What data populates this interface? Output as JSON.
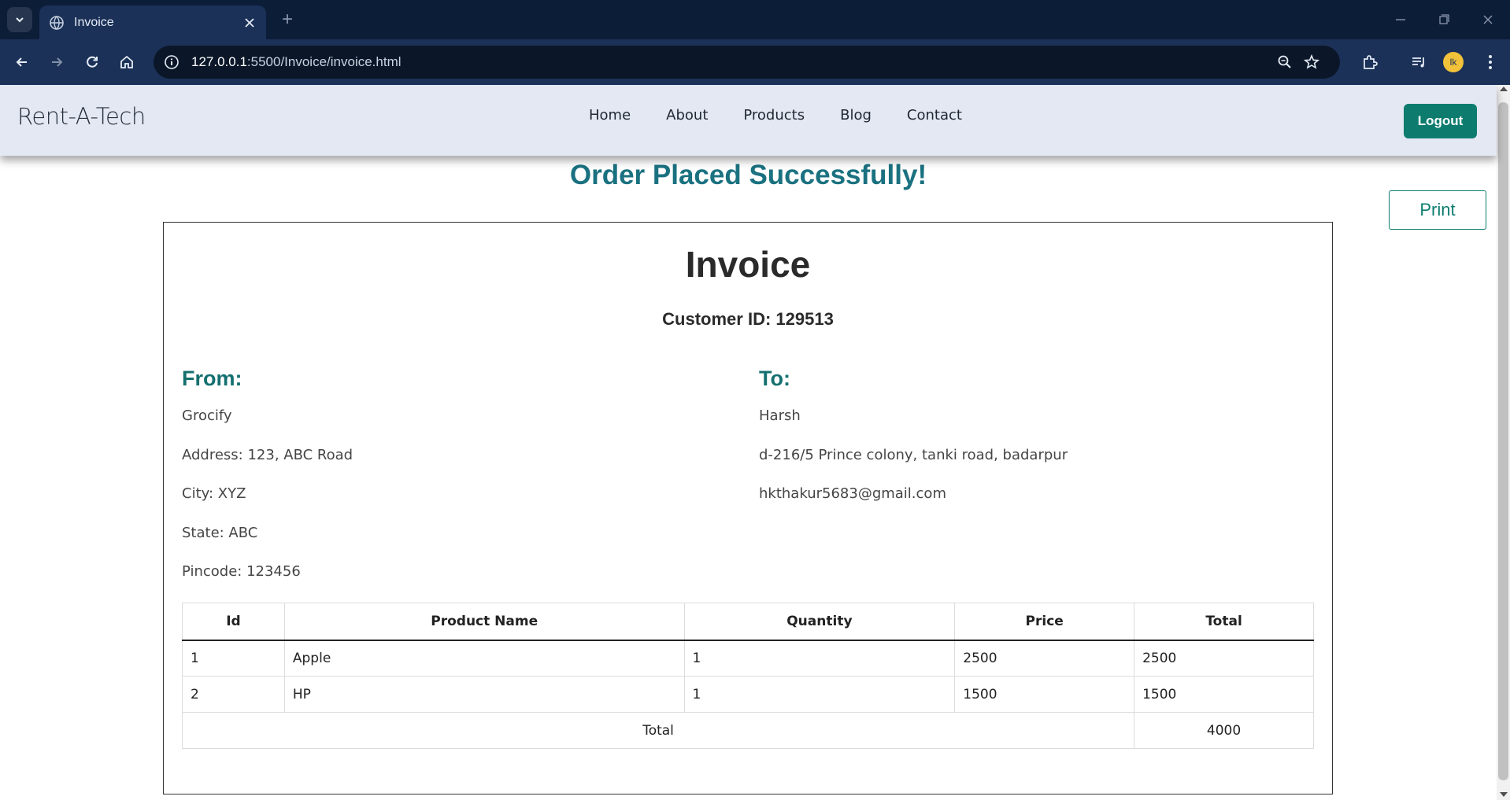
{
  "browser": {
    "tab_title": "Invoice",
    "url_host": "127.0.0.1",
    "url_rest": ":5500/Invoice/invoice.html",
    "avatar_initials": "lk"
  },
  "nav": {
    "brand": "Rent-A-Tech",
    "links": [
      "Home",
      "About",
      "Products",
      "Blog",
      "Contact"
    ],
    "logout_label": "Logout"
  },
  "page": {
    "success_message": "Order Placed Successfully!",
    "print_label": "Print"
  },
  "invoice": {
    "title": "Invoice",
    "customer_id": "Customer ID: 129513",
    "from": {
      "heading": "From:",
      "lines": [
        "Grocify",
        "Address: 123, ABC Road",
        "City: XYZ",
        "State: ABC",
        "Pincode: 123456"
      ]
    },
    "to": {
      "heading": "To:",
      "lines": [
        "Harsh",
        "d-216/5 Prince colony, tanki road, badarpur",
        "hkthakur5683@gmail.com"
      ]
    },
    "table": {
      "headers": [
        "Id",
        "Product Name",
        "Quantity",
        "Price",
        "Total"
      ],
      "rows": [
        [
          "1",
          "Apple",
          "1",
          "2500",
          "2500"
        ],
        [
          "2",
          "HP",
          "1",
          "1500",
          "1500"
        ]
      ],
      "total_label": "Total",
      "total_value": "4000"
    }
  },
  "colors": {
    "accent": "#0d7c6f",
    "heading_teal": "#14706f",
    "success_teal": "#1a7180",
    "nav_bg": "#e4e8f2",
    "chrome_bg": "#0c1d38"
  }
}
